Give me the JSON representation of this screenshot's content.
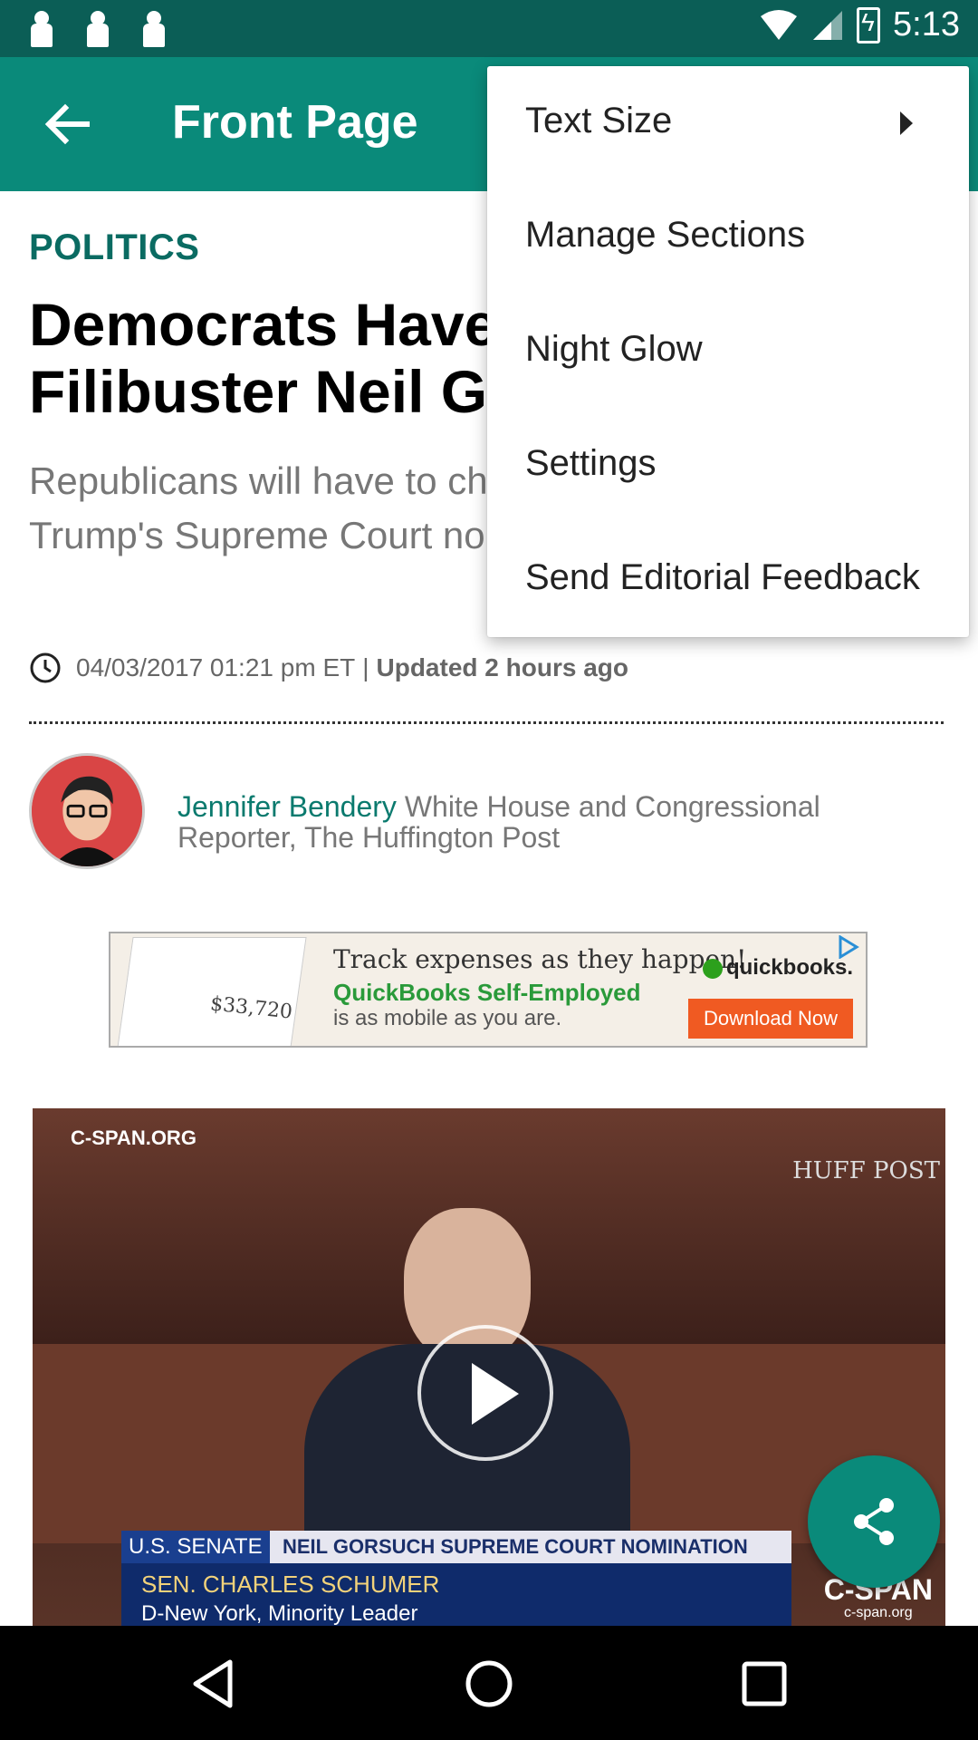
{
  "status_bar": {
    "time": "5:13"
  },
  "app_bar": {
    "title": "Front Page"
  },
  "article": {
    "section": "POLITICS",
    "headline": "Democrats Have The Votes To Filibuster Neil Gorsuch",
    "dek": "Republicans will have to change the rules to confirm Trump's Supreme Court nominee. It's getting ugly.",
    "timestamp": "04/03/2017 01:21 pm ET",
    "separator": "|",
    "updated": "Updated 2 hours ago",
    "author": {
      "name": "Jennifer Bendery",
      "title": "White House and Congressional Reporter, The Huffington Post"
    }
  },
  "ad": {
    "line1": "Track expenses as they happen!",
    "line2": "QuickBooks Self-Employed",
    "line3": "is as mobile as you are.",
    "brand": "quickbooks.",
    "cta": "Download Now",
    "amount": "$33,720"
  },
  "video": {
    "source": "C-SPAN.ORG",
    "watermark": "HUFF POST",
    "chyron_tag": "U.S. SENATE",
    "chyron_topic": "NEIL GORSUCH SUPREME COURT NOMINATION",
    "speaker_name": "SEN. CHARLES SCHUMER",
    "speaker_role": "D-New York, Minority Leader",
    "network": "C-SPAN",
    "network_url": "c-span.org"
  },
  "menu": {
    "items": [
      {
        "label": "Text Size",
        "has_submenu": true
      },
      {
        "label": "Manage Sections"
      },
      {
        "label": "Night Glow"
      },
      {
        "label": "Settings"
      },
      {
        "label": "Send Editorial Feedback"
      }
    ]
  },
  "colors": {
    "primary": "#0a8a7a",
    "status_bar": "#0b5e56",
    "accent_text": "#0a6b62"
  }
}
